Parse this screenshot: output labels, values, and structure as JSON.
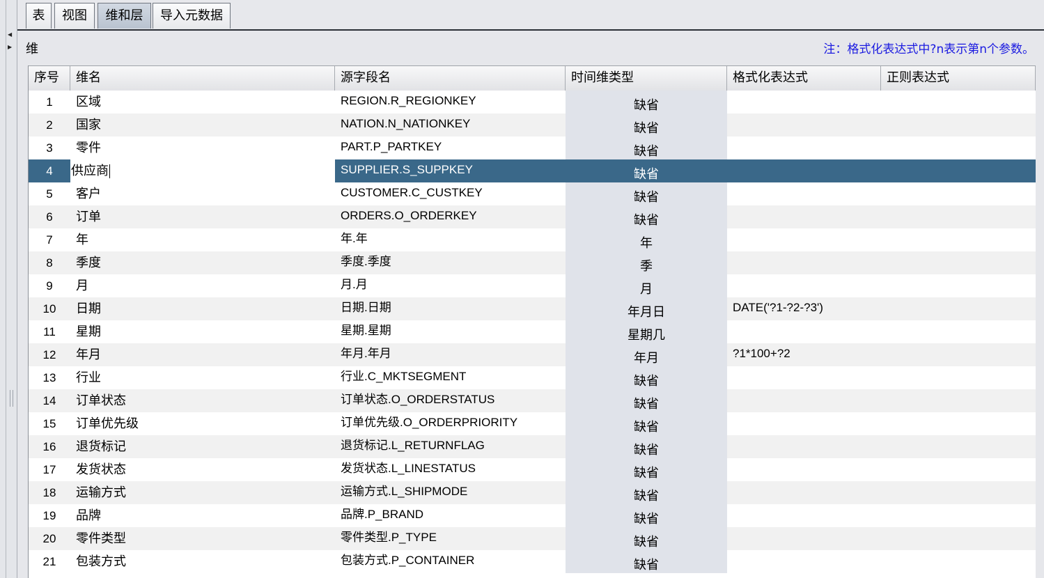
{
  "tabs": [
    {
      "label": "表",
      "active": false
    },
    {
      "label": "视图",
      "active": false
    },
    {
      "label": "维和层",
      "active": true
    },
    {
      "label": "导入元数据",
      "active": false
    }
  ],
  "panel": {
    "title": "维",
    "note": "注：格式化表达式中?n表示第n个参数。"
  },
  "table": {
    "columns": [
      "序号",
      "维名",
      "源字段名",
      "时间维类型",
      "格式化表达式",
      "正则表达式"
    ],
    "selected_row": 4,
    "rows": [
      {
        "idx": "1",
        "name": "区域",
        "source": "REGION.R_REGIONKEY",
        "time_type": "缺省",
        "format": "",
        "regex": ""
      },
      {
        "idx": "2",
        "name": "国家",
        "source": "NATION.N_NATIONKEY",
        "time_type": "缺省",
        "format": "",
        "regex": ""
      },
      {
        "idx": "3",
        "name": "零件",
        "source": "PART.P_PARTKEY",
        "time_type": "缺省",
        "format": "",
        "regex": ""
      },
      {
        "idx": "4",
        "name": "供应商",
        "source": "SUPPLIER.S_SUPPKEY",
        "time_type": "缺省",
        "format": "",
        "regex": ""
      },
      {
        "idx": "5",
        "name": "客户",
        "source": "CUSTOMER.C_CUSTKEY",
        "time_type": "缺省",
        "format": "",
        "regex": ""
      },
      {
        "idx": "6",
        "name": "订单",
        "source": "ORDERS.O_ORDERKEY",
        "time_type": "缺省",
        "format": "",
        "regex": ""
      },
      {
        "idx": "7",
        "name": "年",
        "source": "年.年",
        "time_type": "年",
        "format": "",
        "regex": ""
      },
      {
        "idx": "8",
        "name": "季度",
        "source": "季度.季度",
        "time_type": "季",
        "format": "",
        "regex": ""
      },
      {
        "idx": "9",
        "name": "月",
        "source": "月.月",
        "time_type": "月",
        "format": "",
        "regex": ""
      },
      {
        "idx": "10",
        "name": "日期",
        "source": "日期.日期",
        "time_type": "年月日",
        "format": "DATE('?1-?2-?3')",
        "regex": ""
      },
      {
        "idx": "11",
        "name": "星期",
        "source": "星期.星期",
        "time_type": "星期几",
        "format": "",
        "regex": ""
      },
      {
        "idx": "12",
        "name": "年月",
        "source": "年月.年月",
        "time_type": "年月",
        "format": "?1*100+?2",
        "regex": ""
      },
      {
        "idx": "13",
        "name": "行业",
        "source": "行业.C_MKTSEGMENT",
        "time_type": "缺省",
        "format": "",
        "regex": ""
      },
      {
        "idx": "14",
        "name": "订单状态",
        "source": "订单状态.O_ORDERSTATUS",
        "time_type": "缺省",
        "format": "",
        "regex": ""
      },
      {
        "idx": "15",
        "name": "订单优先级",
        "source": "订单优先级.O_ORDERPRIORITY",
        "time_type": "缺省",
        "format": "",
        "regex": ""
      },
      {
        "idx": "16",
        "name": "退货标记",
        "source": "退货标记.L_RETURNFLAG",
        "time_type": "缺省",
        "format": "",
        "regex": ""
      },
      {
        "idx": "17",
        "name": "发货状态",
        "source": "发货状态.L_LINESTATUS",
        "time_type": "缺省",
        "format": "",
        "regex": ""
      },
      {
        "idx": "18",
        "name": "运输方式",
        "source": "运输方式.L_SHIPMODE",
        "time_type": "缺省",
        "format": "",
        "regex": ""
      },
      {
        "idx": "19",
        "name": "品牌",
        "source": "品牌.P_BRAND",
        "time_type": "缺省",
        "format": "",
        "regex": ""
      },
      {
        "idx": "20",
        "name": "零件类型",
        "source": "零件类型.P_TYPE",
        "time_type": "缺省",
        "format": "",
        "regex": ""
      },
      {
        "idx": "21",
        "name": "包装方式",
        "source": "包装方式.P_CONTAINER",
        "time_type": "缺省",
        "format": "",
        "regex": ""
      }
    ]
  },
  "colors": {
    "selection": "#3a6889",
    "note_text": "#1a1ae0"
  }
}
